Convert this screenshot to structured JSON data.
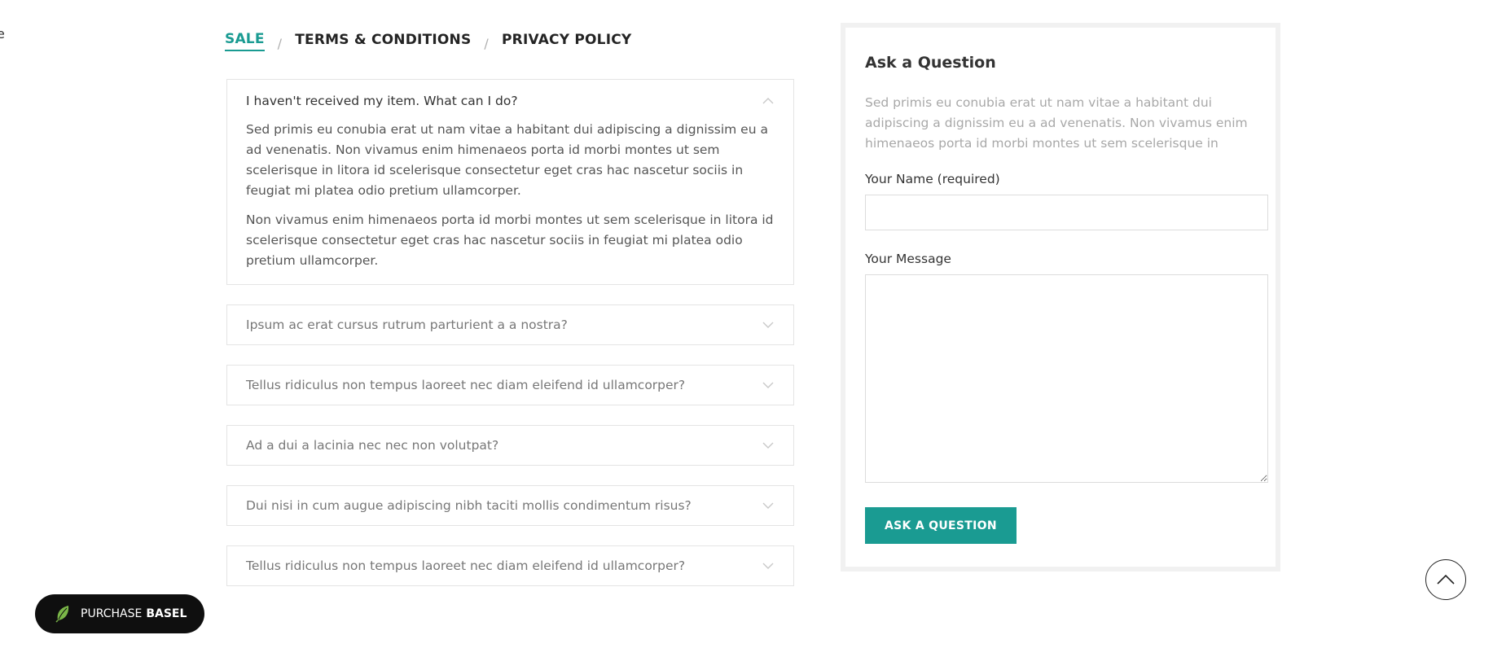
{
  "edge_text": "e",
  "tabs": [
    {
      "label": "SALE",
      "active": true
    },
    {
      "label": "TERMS & CONDITIONS",
      "active": false
    },
    {
      "label": "PRIVACY POLICY",
      "active": false
    }
  ],
  "tab_separator": "/",
  "accordion": {
    "items": [
      {
        "question": "I haven't received my item. What can I do?",
        "open": true,
        "paragraphs": [
          "Sed primis eu conubia erat ut nam vitae a habitant dui adipiscing a dignissim eu a ad venenatis. Non vivamus enim himenaeos porta id morbi montes ut sem scelerisque in litora id scelerisque consectetur eget cras hac nascetur sociis in feugiat mi platea odio pretium ullamcorper.",
          "Non vivamus enim himenaeos porta id morbi montes ut sem scelerisque in litora id scelerisque consectetur eget cras hac nascetur sociis in feugiat mi platea odio pretium ullamcorper."
        ]
      },
      {
        "question": "Ipsum ac erat cursus rutrum parturient a a nostra?",
        "open": false
      },
      {
        "question": "Tellus ridiculus non tempus laoreet nec diam eleifend id ullamcorper?",
        "open": false
      },
      {
        "question": "Ad a dui a lacinia nec nec non volutpat?",
        "open": false
      },
      {
        "question": "Dui nisi in cum augue adipiscing nibh taciti mollis condimentum risus?",
        "open": false
      },
      {
        "question": "Tellus ridiculus non tempus laoreet nec diam eleifend id ullamcorper?",
        "open": false
      }
    ]
  },
  "ask": {
    "title": "Ask a Question",
    "description": "Sed primis eu conubia erat ut nam vitae a habitant dui adipiscing a dignissim eu a ad venenatis. Non vivamus enim himenaeos porta id morbi montes ut sem scelerisque in",
    "name_label": "Your Name (required)",
    "name_value": "",
    "message_label": "Your Message",
    "message_value": "",
    "button_label": "ASK A QUESTION"
  },
  "purchase": {
    "prefix": "PURCHASE",
    "brand": "BASEL"
  },
  "colors": {
    "accent": "#1a9b92",
    "badge_bg": "#0f0f0f",
    "leaf_green": "#7ab648"
  },
  "icons": {
    "accordion_open": "chevron-up-icon",
    "accordion_closed": "chevron-down-icon",
    "scroll_top": "arrow-up-icon",
    "badge": "leaf-icon"
  }
}
